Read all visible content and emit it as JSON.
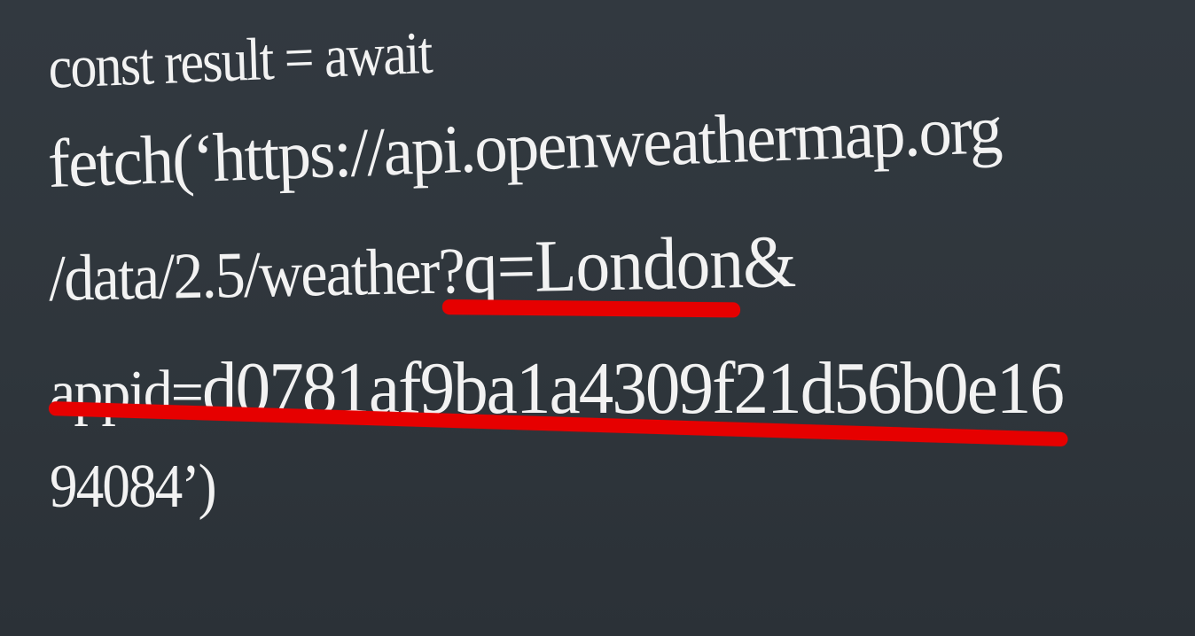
{
  "slide": {
    "background_color": "#30363d",
    "highlight_color": "#e60000",
    "code_lines": {
      "line_1": "const result = await",
      "line_2": "fetch(‘https://api.openweathermap.org",
      "line_3_prefix": "/data/2.5/weather?",
      "line_3_emphasis": "q=London&",
      "line_4_prefix": "appid=",
      "line_4_emphasis": "d0781af9ba1a4309f21d56b0e16",
      "line_5": "94084’)"
    }
  }
}
